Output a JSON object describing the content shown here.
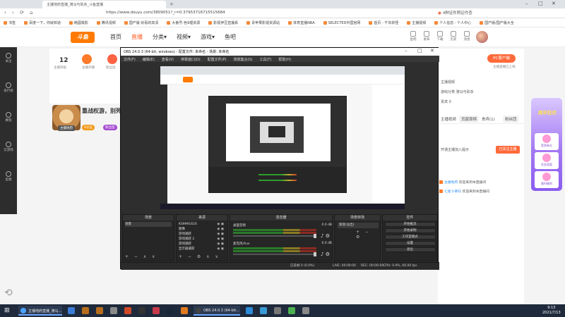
{
  "browser": {
    "tab_title": "主播地府直播_骑马与砍杀_斗鱼直播",
    "url": "https://www.douyu.com/3809051?_r=0.37953716715515684",
    "right_text": "4种证件照证件查",
    "bookmarks": [
      "书签",
      "百度一下，你就知道",
      "韩國電影",
      "腾讯视频",
      "国产版·好看的高清",
      "大番号-色9理资源",
      "影视伊豆直播系",
      "青苹果影视资源站",
      "体育直播NBA",
      "SELECTED中国官网",
      "首页 - 千年妖怪",
      "主播视频",
      "个人信息 - 个人中心",
      "国产版/国产版大全"
    ]
  },
  "douyu": {
    "logo": "斗鱼",
    "nav": [
      "首页",
      "直播",
      "分类▾",
      "视频▾",
      "游戏▾",
      "鱼吧"
    ],
    "top_icons": [
      "鱼吧",
      "发布",
      "下载",
      "历史",
      "消息"
    ],
    "leftbar": [
      "关注",
      "排行榜",
      "赛程",
      "云游戏",
      "鱼塘"
    ],
    "header_num": "12",
    "header_label": "主播等级",
    "header_tag2": "主播开播",
    "header_tag4": "粉丝团",
    "anchor_title": "重战权游，别死枪",
    "anchor_sub": "主播地府",
    "anchor_badge_v": "V认证",
    "anchor_badge_p": "粉丝团",
    "pc_button": "PC客户端",
    "pc_sub": "主播直播已上线",
    "rp_lines": [
      "主播视频",
      "游戏分类 骑马与砍杀",
      "贵宾 0"
    ],
    "rp_tabs": [
      "主播视频",
      "贡献周榜",
      "贵宾(1)",
      "粉丝团"
    ],
    "rp_follow": "已关注主播",
    "rp_follow_note": "开通主播加入提示",
    "chat": [
      {
        "name": "主播地府",
        "text": "欢迎来到本直播间"
      },
      {
        "name": "七星斗佛托",
        "text": "欢迎来到本直播间"
      }
    ],
    "promo_title": "周年狂欢",
    "promo_items": [
      "签到有礼",
      "任务奖励",
      "限时福利"
    ]
  },
  "obs": {
    "title": "OBS 24.0.3 (64-bit, windows) - 配置文件: 未命名 - 场景: 未命名",
    "menu": [
      "文件(F)",
      "编辑(E)",
      "查看(V)",
      "停靠窗口(D)",
      "配置文件(P)",
      "场景集合(S)",
      "工具(T)",
      "帮助(H)"
    ],
    "docks": {
      "scenes_title": "场景",
      "scenes": [
        "场景"
      ],
      "sources_title": "来源",
      "sources": [
        "KS9991616",
        "图像",
        "游戏捕获",
        "游戏捕获 2",
        "游戏捕获",
        "显示器捕获"
      ],
      "mixer_title": "混音器",
      "mixer": [
        {
          "label": "桌面音频",
          "db": "0.0 dB"
        },
        {
          "label": "麦克风/Aux",
          "db": "0.0 dB"
        }
      ],
      "transitions_title": "场景转场",
      "transition_value": "渐变(淡出)",
      "controls_title": "控件",
      "controls": [
        "开始推流",
        "开始录制",
        "工作室模式",
        "设置",
        "退出"
      ]
    },
    "status": {
      "lost": "已丢帧 0 (0.0%)",
      "live": "LIVE: 00:00:00",
      "rec": "REC: 00:00:00",
      "cpu": "CPU: 0.9%, 60.00 fps"
    }
  },
  "taskbar": {
    "apps": [
      "主播地府直播_骑马...",
      "OBS 24.0.3 (64-bit..."
    ],
    "time": "9:13",
    "date": "2021/7/13"
  },
  "colors": {
    "accent": "#ff5d23",
    "obs_bg": "#2e2e2e",
    "taskbar": "#1f2a3c"
  }
}
